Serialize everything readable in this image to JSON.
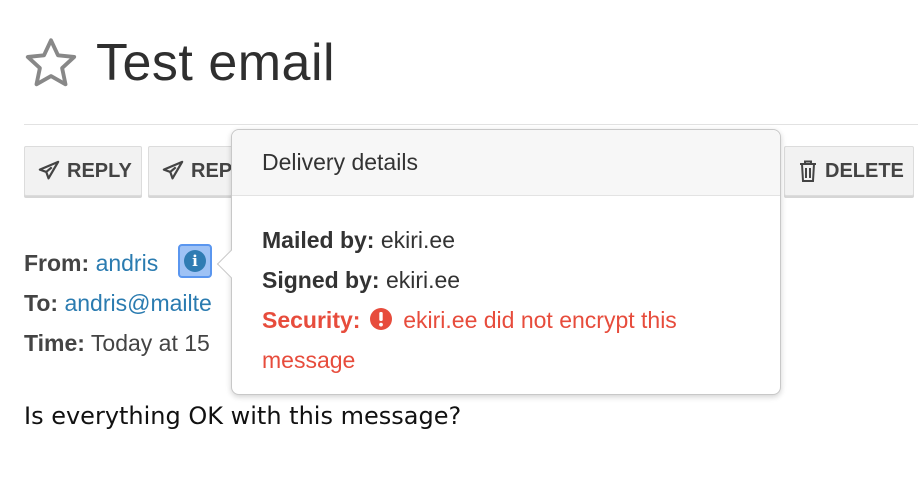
{
  "email": {
    "title": "Test email",
    "body": "Is everything OK with this message?"
  },
  "toolbar": {
    "reply_label": "REPLY",
    "reply_all_label": "REP",
    "delete_label": "DELETE"
  },
  "meta": {
    "from_label": "From:",
    "from_value": "andris",
    "to_label": "To:",
    "to_value": "andris@mailte",
    "time_label": "Time:",
    "time_value": "Today at 15"
  },
  "popover": {
    "title": "Delivery details",
    "mailed_by_label": "Mailed by:",
    "mailed_by_value": "ekiri.ee",
    "signed_by_label": "Signed by:",
    "signed_by_value": "ekiri.ee",
    "security_label": "Security:",
    "security_value": "ekiri.ee did not encrypt this message"
  },
  "icons": {
    "star": "star-outline-icon",
    "reply": "paper-plane-icon",
    "delete": "trash-icon",
    "info": "info-circle-icon",
    "warning": "exclamation-circle-icon"
  },
  "colors": {
    "link": "#2a7bb0",
    "danger": "#e74c3c",
    "info_highlight": "#9ec2f5"
  }
}
